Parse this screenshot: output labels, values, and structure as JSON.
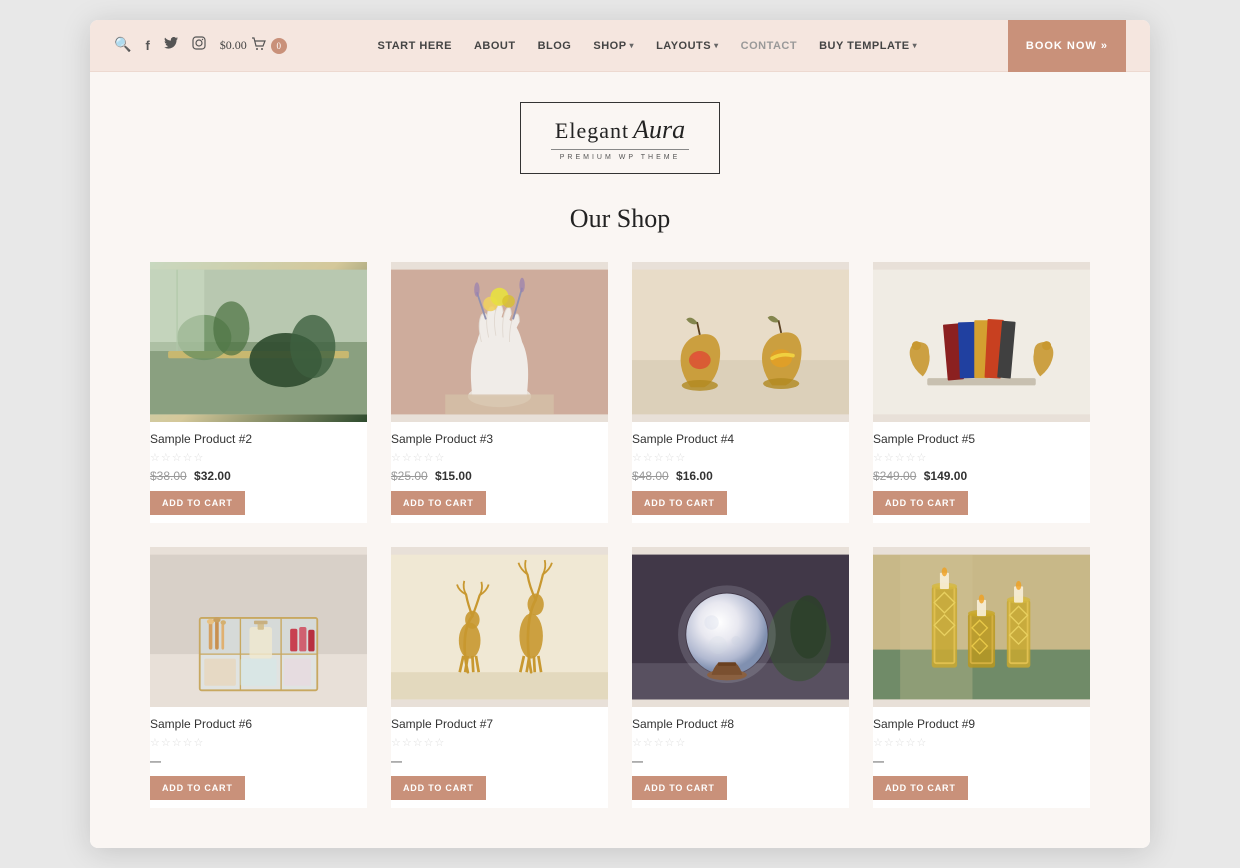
{
  "brand": {
    "name_main": "Elegant",
    "name_script": "Aura",
    "subtitle": "PREMIUM WP THEME",
    "logo_border": "#333"
  },
  "navbar": {
    "price": "$0.00",
    "cart_count": "0",
    "book_now": "BOOK NOW »",
    "links": [
      {
        "id": "start-here",
        "label": "START HERE"
      },
      {
        "id": "about",
        "label": "ABOUT"
      },
      {
        "id": "blog",
        "label": "BLOG"
      },
      {
        "id": "shop",
        "label": "SHOP",
        "has_arrow": true
      },
      {
        "id": "layouts",
        "label": "LAYOUTS",
        "has_arrow": true
      },
      {
        "id": "contact",
        "label": "CONTACT"
      },
      {
        "id": "buy-template",
        "label": "BUY TEMPLATE",
        "has_arrow": true
      }
    ]
  },
  "shop": {
    "title": "Our Shop",
    "products": [
      {
        "id": "p2",
        "name": "Sample Product #2",
        "original_price": "$38.00",
        "sale_price": "$32.00",
        "rating": 0,
        "add_to_cart": "ADD TO CART",
        "image_style": "prod-p2",
        "image_desc": "Decorative leaves and plants desk arrangement"
      },
      {
        "id": "p3",
        "name": "Sample Product #3",
        "original_price": "$25.00",
        "sale_price": "$15.00",
        "rating": 0,
        "add_to_cart": "ADD TO CART",
        "image_style": "prod-p3",
        "image_desc": "White hand-shaped vase with flowers"
      },
      {
        "id": "p4",
        "name": "Sample Product #4",
        "original_price": "$48.00",
        "sale_price": "$16.00",
        "rating": 0,
        "add_to_cart": "ADD TO CART",
        "image_style": "prod-p4",
        "image_desc": "Wooden apple-shaped fruit baskets"
      },
      {
        "id": "p5",
        "name": "Sample Product #5",
        "original_price": "$249.00",
        "sale_price": "$149.00",
        "rating": 0,
        "add_to_cart": "ADD TO CART",
        "image_style": "prod-p5",
        "image_desc": "Golden animal bookend sculpture"
      },
      {
        "id": "p6",
        "name": "Sample Product #6",
        "original_price": null,
        "sale_price": null,
        "rating": 0,
        "add_to_cart": "ADD TO CART",
        "image_style": "prod-p6",
        "image_desc": "Glass makeup organizer with gold details"
      },
      {
        "id": "p7",
        "name": "Sample Product #7",
        "original_price": null,
        "sale_price": null,
        "rating": 0,
        "add_to_cart": "ADD TO CART",
        "image_style": "prod-p7",
        "image_desc": "Gold metallic deer figurines"
      },
      {
        "id": "p8",
        "name": "Sample Product #8",
        "original_price": null,
        "sale_price": null,
        "rating": 0,
        "add_to_cart": "ADD TO CART",
        "image_style": "prod-p8",
        "image_desc": "Moon lamp with wooden base"
      },
      {
        "id": "p9",
        "name": "Sample Product #9",
        "original_price": null,
        "sale_price": null,
        "rating": 0,
        "add_to_cart": "ADD TO CART",
        "image_style": "prod-p9",
        "image_desc": "Gold geometric candle holders set"
      }
    ]
  },
  "icons": {
    "search": "🔍",
    "facebook": "f",
    "twitter": "t",
    "instagram": "i",
    "cart": "🛒",
    "arrow_down": "▾",
    "double_arrow": "»",
    "star_empty": "☆",
    "star_filled": "★"
  },
  "colors": {
    "navbar_bg": "#f5e6df",
    "accent": "#c9917a",
    "page_bg": "#faf6f3",
    "text_dark": "#333",
    "text_muted": "#999"
  }
}
